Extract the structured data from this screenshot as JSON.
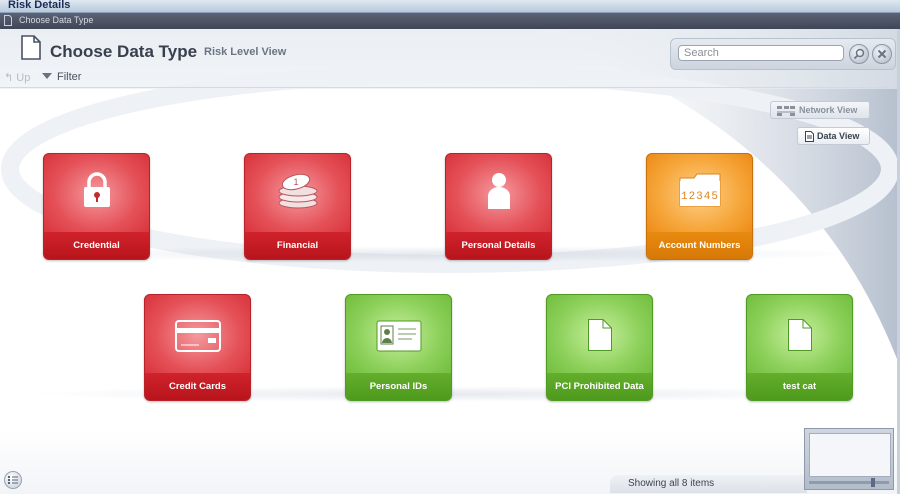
{
  "window": {
    "title": "Risk Details"
  },
  "breadcrumb": {
    "current": "Choose Data Type"
  },
  "header": {
    "title": "Choose Data Type",
    "subtitle": "Risk Level View",
    "search": {
      "placeholder": "Search",
      "value": ""
    }
  },
  "toolbar": {
    "up_label": "Up",
    "filter_label": "Filter"
  },
  "views": {
    "network_label": "Network View",
    "data_label": "Data View",
    "active": "Data View"
  },
  "tiles": [
    {
      "label": "Credential",
      "color": "#d8343c",
      "icon": "lock-icon"
    },
    {
      "label": "Financial",
      "color": "#d8343c",
      "icon": "coins-icon"
    },
    {
      "label": "Personal Details",
      "color": "#d8343c",
      "icon": "person-icon"
    },
    {
      "label": "Account Numbers",
      "color": "#ec8b16",
      "icon": "numbers-folder-icon"
    },
    {
      "label": "Credit Cards",
      "color": "#d8343c",
      "icon": "credit-card-icon"
    },
    {
      "label": "Personal IDs",
      "color": "#72be3e",
      "icon": "id-card-icon"
    },
    {
      "label": "PCI Prohibited Data",
      "color": "#72be3e",
      "icon": "document-icon"
    },
    {
      "label": "test cat",
      "color": "#72be3e",
      "icon": "document-icon"
    }
  ],
  "account_numbers_glyph": "12345",
  "status": {
    "text": "Showing all 8 items"
  }
}
